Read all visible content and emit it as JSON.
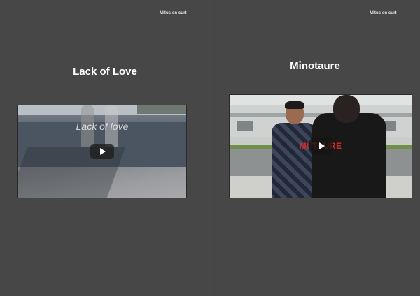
{
  "left_page": {
    "brand": "Mitus en curt",
    "title": "Lack of Love",
    "video": {
      "overlay_text": "Lack of love",
      "play_icon": "play-icon"
    }
  },
  "right_page": {
    "brand": "Mitus en curt",
    "title": "Minotaure",
    "video": {
      "overlay_text": "MI     TAURE",
      "play_icon": "play-icon",
      "accent_color": "#d52b2b"
    }
  },
  "colors": {
    "background": "#474747",
    "title": "#ffffff"
  }
}
